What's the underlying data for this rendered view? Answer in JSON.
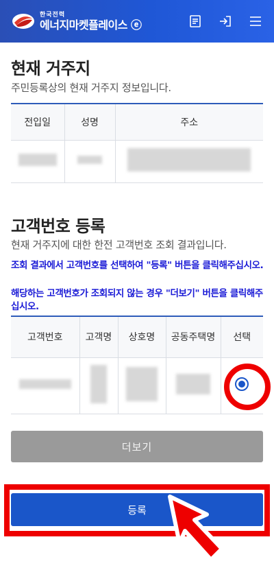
{
  "header": {
    "logo_small": "한국전력",
    "logo_big": "에너지마켓플레이스 ⓔ",
    "icons": [
      "document-icon",
      "login-icon",
      "menu-icon"
    ]
  },
  "residence": {
    "title": "현재 거주지",
    "desc": "주민등록상의 현재 거주지 정보입니다.",
    "columns": [
      "전입일",
      "성명",
      "주소"
    ]
  },
  "customer": {
    "title": "고객번호 등록",
    "desc": "현재 거주지에 대한 한전 고객번호 조회 결과입니다.",
    "notice1": "조회 결과에서 고객번호를 선택하여 \"등록\" 버튼을 클릭해주십시오.",
    "notice2": "해당하는 고객번호가 조회되지 않는 경우 \"더보기\" 버튼을 클릭해주십시오.",
    "columns": [
      "고객번호",
      "고객명",
      "상호명",
      "공동주택명",
      "선택"
    ],
    "selected": true
  },
  "buttons": {
    "more": "더보기",
    "register": "등록"
  },
  "colors": {
    "brand": "#1f57d6",
    "highlight": "#e00000",
    "notice": "#1a1ad6"
  }
}
